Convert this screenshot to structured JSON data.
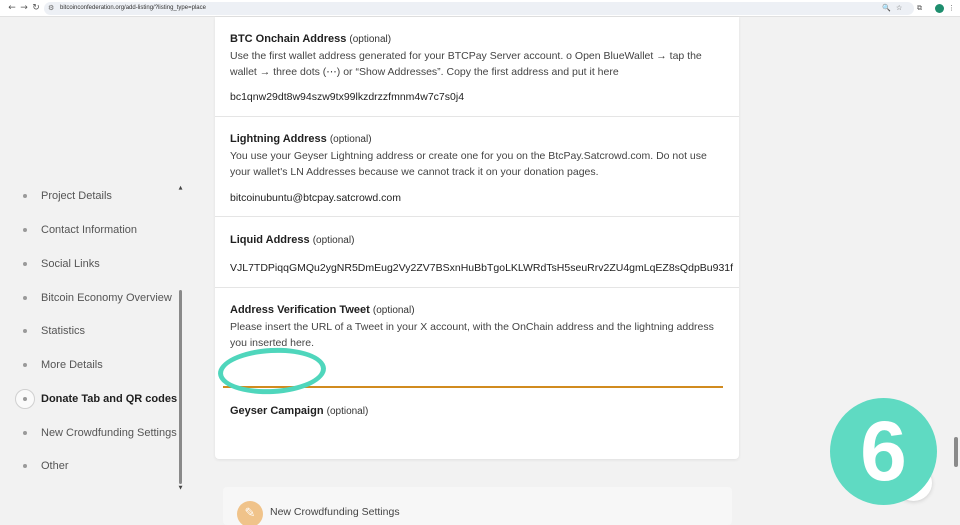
{
  "browser": {
    "back_icon": "←",
    "forward_icon": "→",
    "reload_icon": "↻",
    "url": "bitcoinconfederation.org/add-listing/?listing_type=place",
    "tune_icon": "⚙",
    "zoom_icon": "🔍",
    "share_icon": "⇪",
    "star_icon": "☆",
    "extensions_icon": "⧉",
    "menu_icon": "⋮"
  },
  "sidebar": {
    "items": [
      {
        "label": "Project Details"
      },
      {
        "label": "Contact Information"
      },
      {
        "label": "Social Links"
      },
      {
        "label": "Bitcoin Economy Overview"
      },
      {
        "label": "Statistics"
      },
      {
        "label": "More Details"
      },
      {
        "label": "Donate Tab and QR codes",
        "active": true
      },
      {
        "label": "New Crowdfunding Settings"
      },
      {
        "label": "Other"
      }
    ],
    "scroll_up": "▲",
    "scroll_down": "▼"
  },
  "form": {
    "onchain": {
      "title": "BTC Onchain Address",
      "optional": "(optional)",
      "desc": "Use the first wallet address generated for your BTCPay Server account. o Open BlueWallet → tap the wallet → three dots (⋯) or “Show Addresses”. Copy the first address and put it here",
      "value": "bc1qnw29dt8w94szw9tx99lkzdrzzfmnm4w7c7s0j4"
    },
    "lightning": {
      "title": "Lightning Address",
      "optional": "(optional)",
      "desc": "You use your Geyser Lightning address or create one for you on the BtcPay.Satcrowd.com. Do not use your wallet's LN Addresses because we cannot track it on your donation pages.",
      "value": "bitcoinubuntu@btcpay.satcrowd.com"
    },
    "liquid": {
      "title": "Liquid Address",
      "optional": "(optional)",
      "value": "VJL7TDPiqqGMQu2ygNR5DmEug2Vy2ZV7BSxnHuBbTgoLKLWRdTsH5seuRrv2ZU4gmLqEZ8sQdpBu931f"
    },
    "tweet": {
      "title": "Address Verification Tweet",
      "optional": "(optional)",
      "desc": "Please insert the URL of a Tweet in your X account, with the OnChain address and the lightning address you inserted here.",
      "value": ""
    },
    "geyser": {
      "title": "Geyser Campaign",
      "optional": "(optional)"
    }
  },
  "next_section": {
    "icon": "✎",
    "label": "New Crowdfunding Settings"
  },
  "step_badge": {
    "number": "6"
  },
  "colors": {
    "accent_teal": "#5fdac2",
    "input_underline": "#d18b1f",
    "section_icon": "#f0c38a"
  }
}
